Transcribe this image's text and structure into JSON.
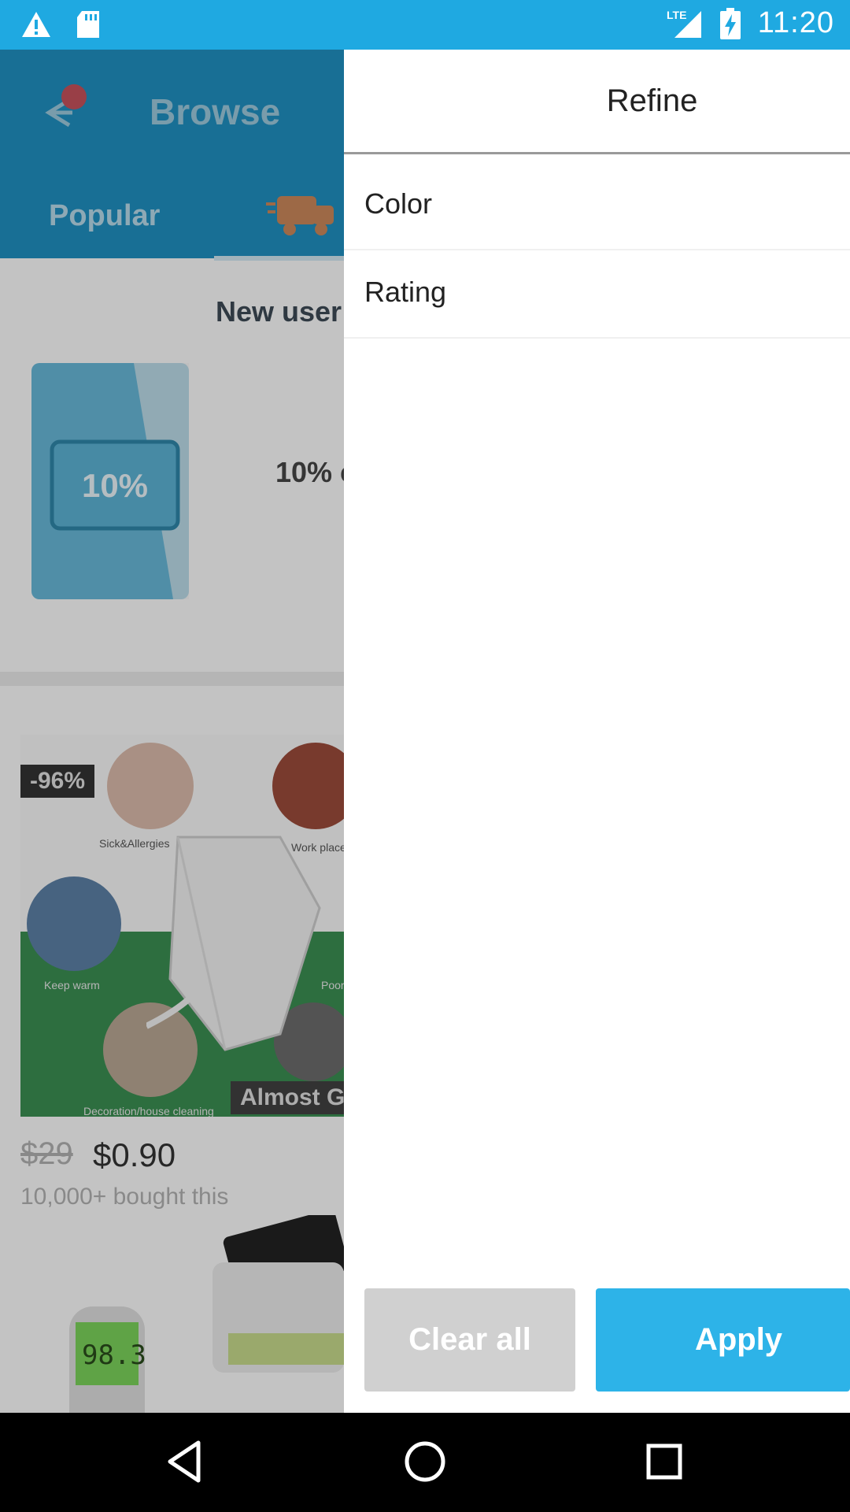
{
  "status_bar": {
    "time": "11:20",
    "network": "LTE",
    "icons": [
      "warning-icon",
      "sd-card-icon",
      "signal-icon",
      "battery-charging-icon"
    ]
  },
  "background": {
    "title": "Browse",
    "tab_popular": "Popular",
    "new_user_text": "New user",
    "coupon_label": "10%",
    "coupon_text": "10% c",
    "product": {
      "discount_badge": "-96%",
      "captions": [
        "Sick&Allergies",
        "Work place",
        "Keep warm",
        "Poor",
        "Decoration/house cleaning"
      ],
      "tag": "Almost G",
      "price_old": "$29",
      "price_new": "$0.90",
      "bought": "10,000+ bought this"
    },
    "thermo_reading": "98.3"
  },
  "drawer": {
    "title": "Refine",
    "filters": [
      {
        "label": "Color"
      },
      {
        "label": "Rating"
      }
    ],
    "clear_label": "Clear all",
    "apply_label": "Apply"
  },
  "colors": {
    "accent": "#2db3e8",
    "status_bar": "#1fa9e1",
    "header": "#1f8fbf",
    "clear_button": "#d0d0d0"
  }
}
